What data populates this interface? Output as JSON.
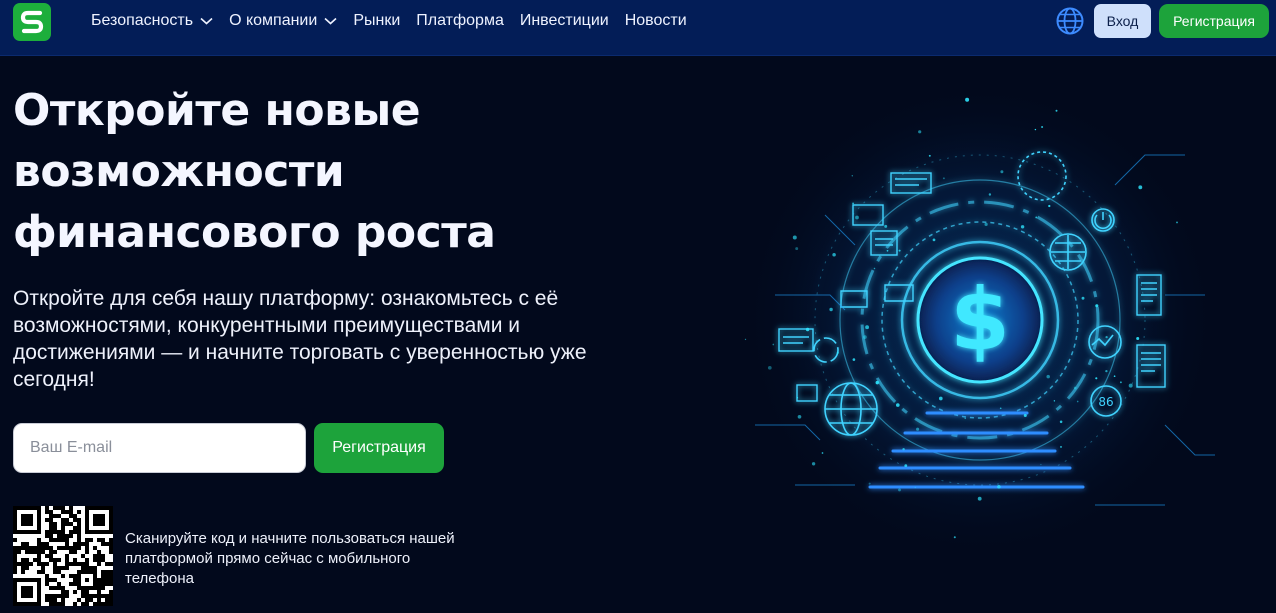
{
  "nav": {
    "items": [
      {
        "label": "Безопасность",
        "has_dropdown": true
      },
      {
        "label": "О компании",
        "has_dropdown": true
      },
      {
        "label": "Рынки",
        "has_dropdown": false
      },
      {
        "label": "Платформа",
        "has_dropdown": false
      },
      {
        "label": "Инвестиции",
        "has_dropdown": false
      },
      {
        "label": "Новости",
        "has_dropdown": false
      }
    ],
    "login_label": "Вход",
    "register_label": "Регистрация"
  },
  "hero": {
    "title": "Откройте новые возможности финансового роста",
    "subtitle": "Откройте для себя нашу платформу: ознакомьтесь с её возможностями, конкурентными преимуществами и достижениями — и начните торговать с уверенностью уже сегодня!",
    "email_placeholder": "Ваш E-mail",
    "register_label": "Регистрация",
    "qr_text": "Сканируйте код и начните пользоваться нашей платформой прямо сейчас с мобильного телефона",
    "illustration_badge": "86"
  },
  "colors": {
    "nav_bg": "#031d57",
    "page_bg": "#02091c",
    "accent_green": "#1da33b",
    "login_bg": "#cfe0fb",
    "glow": "#2ee6ff"
  },
  "icons": {
    "logo": "logo-s-icon",
    "dropdown": "chevron-down-icon",
    "language": "globe-icon",
    "illustration_center": "dollar-sign-icon"
  }
}
